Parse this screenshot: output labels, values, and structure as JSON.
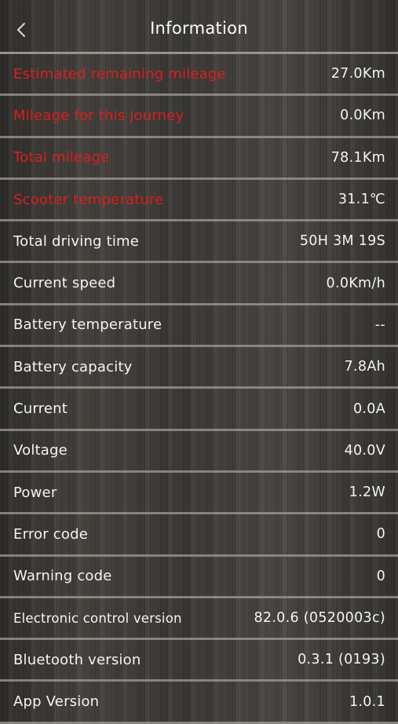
{
  "header": {
    "title": "Information",
    "back_icon": "chevron-left-icon"
  },
  "colors": {
    "highlight_label": "#d91e1e",
    "text": "#f4f4f4",
    "divider": "#a09c96"
  },
  "rows": [
    {
      "label": "Estimated remaining mileage",
      "value": "27.0Km",
      "highlight": true
    },
    {
      "label": "Mileage for this journey",
      "value": "0.0Km",
      "highlight": true
    },
    {
      "label": "Total mileage",
      "value": "78.1Km",
      "highlight": true
    },
    {
      "label": "Scooter temperature",
      "value": "31.1℃",
      "highlight": true
    },
    {
      "label": "Total driving time",
      "value": "50H 3M 19S",
      "highlight": false
    },
    {
      "label": "Current speed",
      "value": "0.0Km/h",
      "highlight": false
    },
    {
      "label": "Battery temperature",
      "value": "--",
      "highlight": false
    },
    {
      "label": "Battery capacity",
      "value": "7.8Ah",
      "highlight": false
    },
    {
      "label": "Current",
      "value": "0.0A",
      "highlight": false
    },
    {
      "label": "Voltage",
      "value": "40.0V",
      "highlight": false
    },
    {
      "label": "Power",
      "value": "1.2W",
      "highlight": false
    },
    {
      "label": "Error code",
      "value": "0",
      "highlight": false
    },
    {
      "label": "Warning code",
      "value": "0",
      "highlight": false
    },
    {
      "label": "Electronic control version",
      "value": "82.0.6 (0520003c)",
      "highlight": false
    },
    {
      "label": "Bluetooth version",
      "value": "0.3.1 (0193)",
      "highlight": false
    },
    {
      "label": "App Version",
      "value": "1.0.1",
      "highlight": false
    }
  ]
}
